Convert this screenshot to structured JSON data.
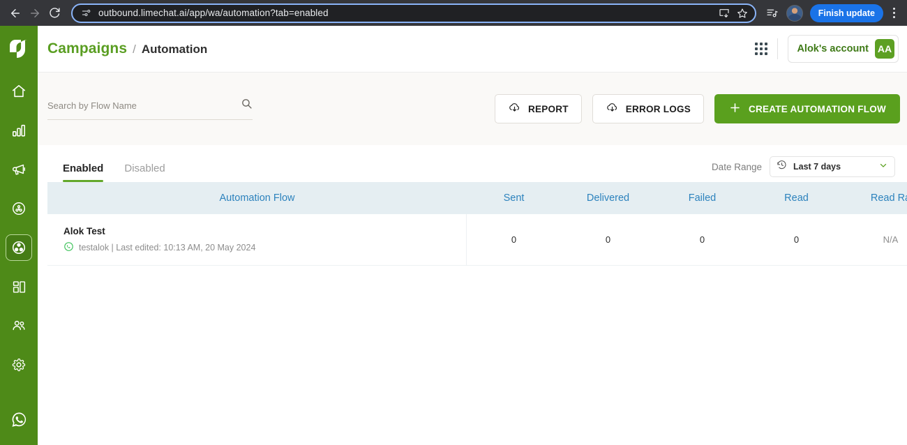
{
  "browser": {
    "back_icon": "back-arrow-icon",
    "forward_icon": "forward-arrow-icon",
    "reload_icon": "reload-icon",
    "site_info_icon": "site-settings-icon",
    "url": "outbound.limechat.ai/app/wa/automation?tab=enabled",
    "install_icon": "install-app-icon",
    "bookmark_icon": "bookmark-star-icon",
    "media_icon": "media-playlist-icon",
    "profile_icon": "profile-avatar",
    "finish_update_label": "Finish update",
    "menu_icon": "kebab-menu-icon",
    "accent": "#1a73e8"
  },
  "sidebar": {
    "brand_icon": "limechat-leaf-logo",
    "brand_color": "#4e8a18",
    "items": [
      {
        "icon": "home-icon",
        "name": "home",
        "active": false
      },
      {
        "icon": "bar-chart-icon",
        "name": "analytics",
        "active": false
      },
      {
        "icon": "megaphone-icon",
        "name": "campaigns",
        "active": false
      },
      {
        "icon": "journey-circle-icon",
        "name": "journeys",
        "active": false
      },
      {
        "icon": "automation-nodes-icon",
        "name": "automation",
        "active": true
      },
      {
        "icon": "layout-dashboard-icon",
        "name": "templates",
        "active": false
      },
      {
        "icon": "users-icon",
        "name": "audience",
        "active": false
      },
      {
        "icon": "gear-icon",
        "name": "settings",
        "active": false
      },
      {
        "icon": "whatsapp-icon",
        "name": "whatsapp",
        "active": false
      }
    ]
  },
  "header": {
    "breadcrumb_root": "Campaigns",
    "breadcrumb_separator": "/",
    "breadcrumb_leaf": "Automation",
    "apps_grid_icon": "apps-grid-icon",
    "account_name": "Alok's account",
    "account_initials": "AA",
    "root_color": "#5a9e22",
    "account_color": "#3f7a17"
  },
  "toolbar": {
    "search_placeholder": "Search by Flow Name",
    "search_value": "",
    "search_icon": "search-icon",
    "report_label": "REPORT",
    "report_icon": "cloud-download-icon",
    "error_logs_label": "ERROR LOGS",
    "error_logs_icon": "cloud-download-icon",
    "create_label": "CREATE AUTOMATION FLOW",
    "create_icon": "plus-icon",
    "primary_color": "#5aa01e"
  },
  "tabs": [
    {
      "label": "Enabled",
      "active": true
    },
    {
      "label": "Disabled",
      "active": false
    }
  ],
  "date_range": {
    "label": "Date Range",
    "icon": "history-clock-icon",
    "value": "Last 7 days",
    "chevron_icon": "chevron-down-icon"
  },
  "table": {
    "columns": [
      "Automation Flow",
      "Sent",
      "Delivered",
      "Failed",
      "Read",
      "Read Ra"
    ],
    "header_color": "#2c82bd",
    "header_bg": "#e5eef2",
    "rows": [
      {
        "name": "Alok Test",
        "channel_icon": "whatsapp-icon",
        "meta": "testalok | Last edited: 10:13 AM, 20 May 2024",
        "sent": "0",
        "delivered": "0",
        "failed": "0",
        "read": "0",
        "read_rate": "N/A"
      }
    ]
  }
}
